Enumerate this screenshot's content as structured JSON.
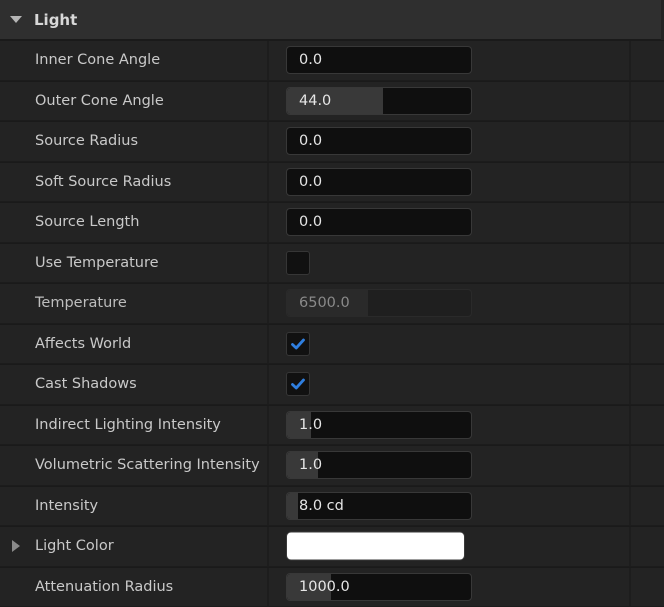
{
  "section": {
    "title": "Light",
    "expanded": true
  },
  "colors": {
    "accent_check": "#2f7fe0",
    "light_color_value": "#ffffff"
  },
  "rows": [
    {
      "label": "Inner Cone Angle",
      "type": "number",
      "value": "0.0",
      "fill_fraction": 0.0
    },
    {
      "label": "Outer Cone Angle",
      "type": "number",
      "value": "44.0",
      "fill_fraction": 0.52
    },
    {
      "label": "Source Radius",
      "type": "number",
      "value": "0.0",
      "fill_fraction": 0.0
    },
    {
      "label": "Soft Source Radius",
      "type": "number",
      "value": "0.0",
      "fill_fraction": 0.0
    },
    {
      "label": "Source Length",
      "type": "number",
      "value": "0.0",
      "fill_fraction": 0.0
    },
    {
      "label": "Use Temperature",
      "type": "checkbox",
      "checked": false
    },
    {
      "label": "Temperature",
      "type": "number",
      "value": "6500.0",
      "fill_fraction": 0.44,
      "disabled": true
    },
    {
      "label": "Affects World",
      "type": "checkbox",
      "checked": true
    },
    {
      "label": "Cast Shadows",
      "type": "checkbox",
      "checked": true
    },
    {
      "label": "Indirect Lighting Intensity",
      "type": "number",
      "value": "1.0",
      "fill_fraction": 0.13
    },
    {
      "label": "Volumetric Scattering Intensity",
      "type": "number",
      "value": "1.0",
      "fill_fraction": 0.17
    },
    {
      "label": "Intensity",
      "type": "number",
      "value": "8.0 cd",
      "fill_fraction": 0.06
    },
    {
      "label": "Light Color",
      "type": "color",
      "value": "#ffffff",
      "expandable": true
    },
    {
      "label": "Attenuation Radius",
      "type": "number",
      "value": "1000.0",
      "fill_fraction": 0.24
    }
  ]
}
